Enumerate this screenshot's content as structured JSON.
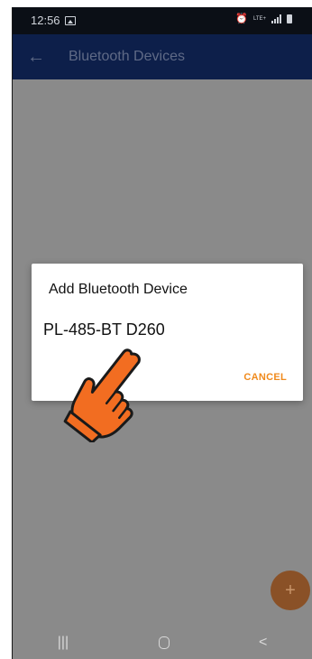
{
  "status": {
    "time": "12:56",
    "lte": "LTE+"
  },
  "appbar": {
    "back": "←",
    "title": "Bluetooth Devices"
  },
  "dialog": {
    "title": "Add Bluetooth Device",
    "device": "PL-485-BT D260",
    "cancel": "CANCEL"
  },
  "fab": {
    "label": "+"
  },
  "nav": {
    "recents": "|||",
    "back": "<"
  },
  "colors": {
    "appbar": "#0d1f4a",
    "accent": "#f08a1c",
    "hand": "#f26d21",
    "scrim": "#8a8a8a"
  },
  "icons": [
    "image-icon",
    "alarm-icon",
    "signal-icon",
    "battery-icon",
    "back-arrow-icon",
    "pointing-hand-icon",
    "home-icon"
  ]
}
